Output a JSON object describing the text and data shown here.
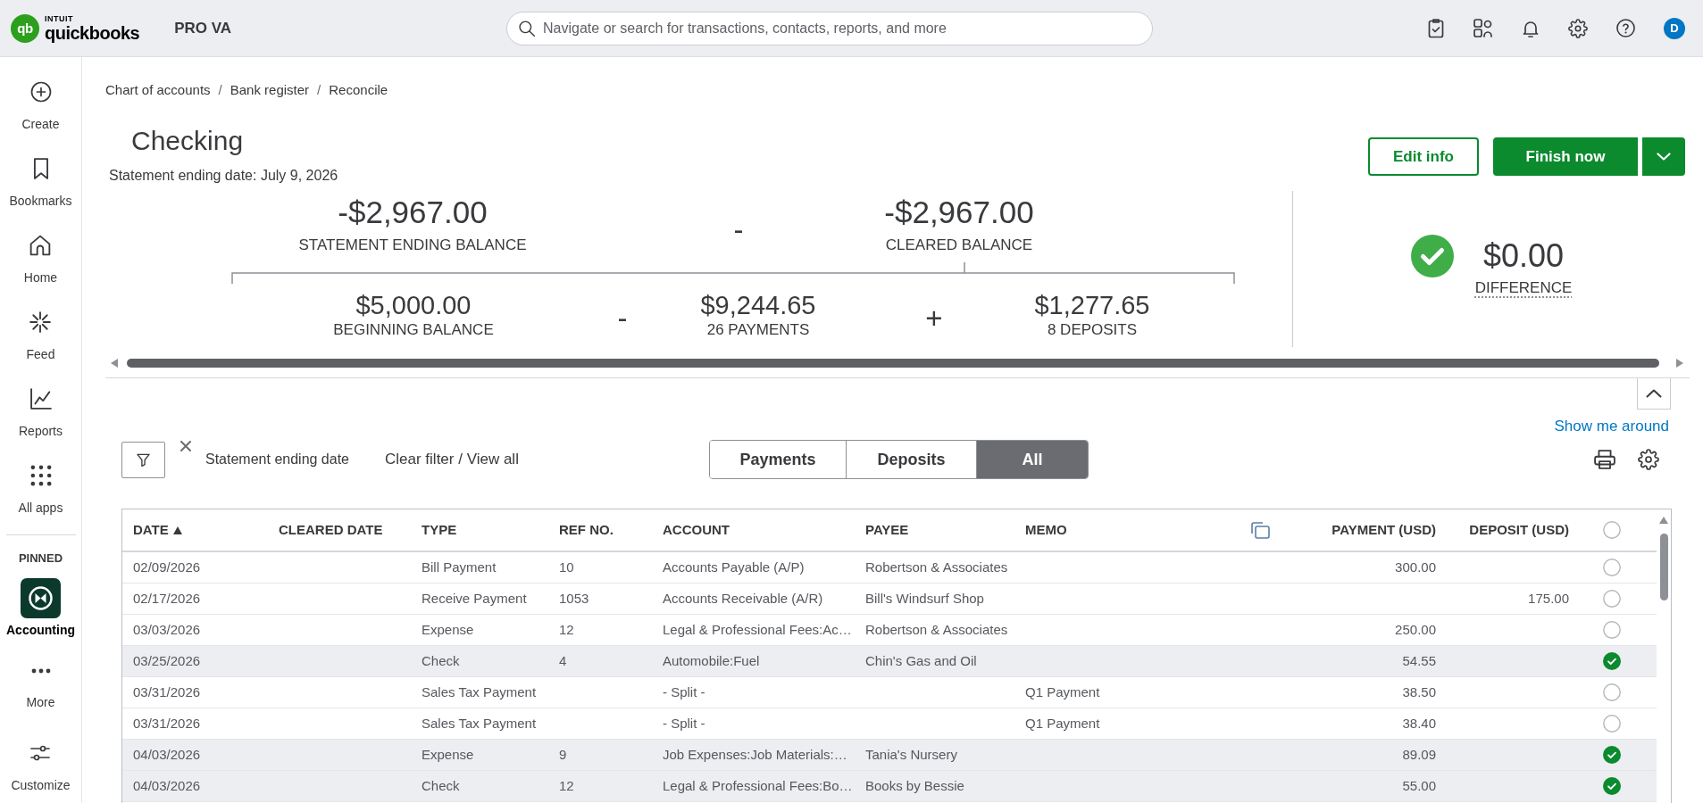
{
  "top_bar": {
    "logo": {
      "mark": "qb",
      "wordmark_top": "INTUIT",
      "wordmark": "quickbooks"
    },
    "company": "PRO VA",
    "search": {
      "placeholder": "Navigate or search for transactions, contacts, reports, and more"
    },
    "avatar": "D"
  },
  "sidebar": {
    "items": [
      {
        "label": "Create",
        "selected": false
      },
      {
        "label": "Bookmarks",
        "selected": false
      },
      {
        "label": "Home",
        "selected": false
      },
      {
        "label": "Feed",
        "selected": false
      },
      {
        "label": "Reports",
        "selected": false
      },
      {
        "label": "All apps",
        "selected": false
      }
    ],
    "pinned_heading": "PINNED",
    "pinned": [
      {
        "label": "Accounting",
        "selected": true
      }
    ],
    "footer_items": [
      {
        "label": "More",
        "selected": false
      },
      {
        "label": "Customize",
        "selected": false
      }
    ]
  },
  "breadcrumb": [
    {
      "label": "Chart of accounts",
      "separator": "/"
    },
    {
      "label": "Bank register",
      "separator": "/"
    },
    {
      "label": "Reconcile"
    }
  ],
  "header": {
    "title": "Checking",
    "statement_date": "Statement ending date: July 9, 2026",
    "buttons": {
      "edit": "Edit info",
      "finish": "Finish now"
    }
  },
  "summary": {
    "statement_ending_balance": {
      "amount": "-$2,967.00",
      "label": "STATEMENT ENDING BALANCE"
    },
    "operator_1": "-",
    "cleared_balance": {
      "amount": "-$2,967.00",
      "label": "CLEARED BALANCE"
    },
    "beginning_balance": {
      "amount": "$5,000.00",
      "label": "BEGINNING BALANCE"
    },
    "operator_2": "-",
    "payments": {
      "amount": "$9,244.65",
      "label": "26 PAYMENTS"
    },
    "operator_3": "+",
    "deposits": {
      "amount": "$1,277.65",
      "label": "8 DEPOSITS"
    },
    "difference": {
      "amount": "$0.00",
      "label": "DIFFERENCE",
      "balanced": true
    }
  },
  "show_me_around": "Show me around",
  "filter": {
    "active_filter": "Statement ending date",
    "clear_link": "Clear filter / View all"
  },
  "segments": [
    {
      "label": "Payments",
      "selected": false
    },
    {
      "label": "Deposits",
      "selected": false
    },
    {
      "label": "All",
      "selected": true
    }
  ],
  "table": {
    "columns": [
      {
        "kind": "text",
        "label": "DATE",
        "sorted": true
      },
      {
        "kind": "text",
        "label": "CLEARED DATE",
        "sorted": false
      },
      {
        "kind": "text",
        "label": "TYPE",
        "sorted": false
      },
      {
        "kind": "text",
        "label": "REF NO.",
        "sorted": false
      },
      {
        "kind": "text",
        "label": "ACCOUNT",
        "sorted": false
      },
      {
        "kind": "text",
        "label": "PAYEE",
        "sorted": false
      },
      {
        "kind": "text",
        "label": "MEMO",
        "sorted": false
      },
      {
        "kind": "icon"
      },
      {
        "kind": "text",
        "label": "PAYMENT (USD)",
        "sorted": false
      },
      {
        "kind": "text",
        "label": "DEPOSIT (USD)",
        "sorted": false
      },
      {
        "kind": "checkbox",
        "checked": false
      }
    ],
    "rows": [
      {
        "date": "02/09/2026",
        "type": "Bill Payment",
        "ref_no": "10",
        "account": "Accounts Payable (A/P)",
        "payee": "Robertson & Associates",
        "payment": "300.00",
        "cleared": false
      },
      {
        "date": "02/17/2026",
        "type": "Receive Payment",
        "ref_no": "1053",
        "account": "Accounts Receivable (A/R)",
        "payee": "Bill's Windsurf Shop",
        "deposit": "175.00",
        "cleared": false
      },
      {
        "date": "03/03/2026",
        "type": "Expense",
        "ref_no": "12",
        "account": "Legal & Professional Fees:Ac…",
        "payee": "Robertson & Associates",
        "payment": "250.00",
        "cleared": false
      },
      {
        "date": "03/25/2026",
        "type": "Check",
        "ref_no": "4",
        "account": "Automobile:Fuel",
        "payee": "Chin's Gas and Oil",
        "payment": "54.55",
        "cleared": true
      },
      {
        "date": "03/31/2026",
        "type": "Sales Tax Payment",
        "account": "- Split -",
        "memo": "Q1 Payment",
        "payment": "38.50",
        "cleared": false
      },
      {
        "date": "03/31/2026",
        "type": "Sales Tax Payment",
        "account": "- Split -",
        "memo": "Q1 Payment",
        "payment": "38.40",
        "cleared": false
      },
      {
        "date": "04/03/2026",
        "type": "Expense",
        "ref_no": "9",
        "account": "Job Expenses:Job Materials:…",
        "payee": "Tania's Nursery",
        "payment": "89.09",
        "cleared": true
      },
      {
        "date": "04/03/2026",
        "type": "Check",
        "ref_no": "12",
        "account": "Legal & Professional Fees:Bo…",
        "payee": "Books by Bessie",
        "payment": "55.00",
        "cleared": true
      }
    ]
  }
}
